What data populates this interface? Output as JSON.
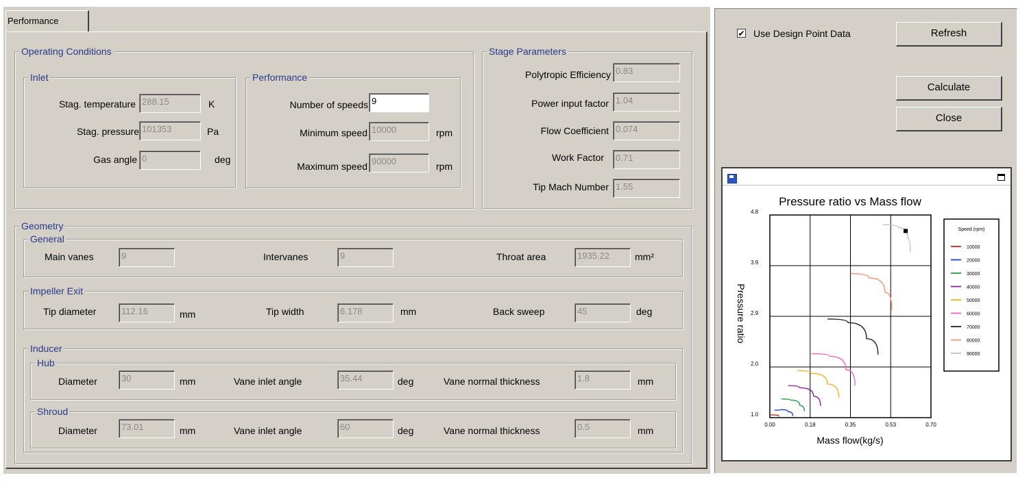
{
  "tab": {
    "label": "Performance"
  },
  "operating": {
    "title": "Operating Conditions",
    "inlet": {
      "title": "Inlet",
      "stag_temp": {
        "label": "Stag. temperature",
        "value": "288.15",
        "unit": "K"
      },
      "stag_pressure": {
        "label": "Stag. pressure",
        "value": "101353",
        "unit": "Pa"
      },
      "gas_angle": {
        "label": "Gas angle",
        "value": "0",
        "unit": "deg"
      }
    },
    "performance": {
      "title": "Performance",
      "num_speeds": {
        "label": "Number of speeds",
        "value": "9"
      },
      "min_speed": {
        "label": "Minimum speed",
        "value": "10000",
        "unit": "rpm"
      },
      "max_speed": {
        "label": "Maximum speed",
        "value": "90000",
        "unit": "rpm"
      }
    }
  },
  "stage": {
    "title": "Stage Parameters",
    "poly_eff": {
      "label": "Polytropic Efficiency",
      "value": "0.83"
    },
    "power_input": {
      "label": "Power input factor",
      "value": "1.04"
    },
    "flow_coef": {
      "label": "Flow Coefficient",
      "value": "0.074"
    },
    "work_factor": {
      "label": "Work Factor",
      "value": "0.71"
    },
    "tip_mach": {
      "label": "Tip Mach Number",
      "value": "1.55"
    }
  },
  "geometry": {
    "title": "Geometry",
    "general": {
      "title": "General",
      "main_vanes": {
        "label": "Main vanes",
        "value": "9"
      },
      "intervanes": {
        "label": "Intervanes",
        "value": "9"
      },
      "throat_area": {
        "label": "Throat area",
        "value": "1935.22",
        "unit": "mm²"
      }
    },
    "impeller_exit": {
      "title": "Impeller Exit",
      "tip_diameter": {
        "label": "Tip diameter",
        "value": "112.16",
        "unit": "mm"
      },
      "tip_width": {
        "label": "Tip width",
        "value": "6.178",
        "unit": "mm"
      },
      "back_sweep": {
        "label": "Back sweep",
        "value": "45",
        "unit": "deg"
      }
    },
    "inducer": {
      "title": "Inducer",
      "hub": {
        "title": "Hub",
        "diameter": {
          "label": "Diameter",
          "value": "30",
          "unit": "mm"
        },
        "vane_inlet_angle": {
          "label": "Vane inlet angle",
          "value": "35.44",
          "unit": "deg"
        },
        "vane_thickness": {
          "label": "Vane normal thickness",
          "value": "1.8",
          "unit": "mm"
        }
      },
      "shroud": {
        "title": "Shroud",
        "diameter": {
          "label": "Diameter",
          "value": "73.01",
          "unit": "mm"
        },
        "vane_inlet_angle": {
          "label": "Vane inlet angle",
          "value": "60",
          "unit": "deg"
        },
        "vane_thickness": {
          "label": "Vane normal thickness",
          "value": "0.5",
          "unit": "mm"
        }
      }
    }
  },
  "controls": {
    "use_design_point": {
      "label": "Use Design Point Data",
      "checked": true
    },
    "refresh": "Refresh",
    "calculate": "Calculate",
    "close": "Close"
  },
  "icons": {
    "save": "save-icon",
    "maximize": "maximize-icon",
    "check": "check-icon"
  },
  "colors": {
    "panel": "#d4d0c8",
    "group_title": "#2a3a8a",
    "disabled_text": "#8c8a84"
  },
  "chart_data": {
    "type": "line",
    "title": "Pressure ratio vs Mass flow",
    "xlabel": "Mass flow(kg/s)",
    "ylabel": "Pressure ratio",
    "xlim": [
      0,
      0.7
    ],
    "ylim": [
      1.0,
      4.8
    ],
    "xticks": [
      "0.00",
      "0.18",
      "0.35",
      "0.53",
      "0.70"
    ],
    "yticks": [
      "1.0",
      "2.0",
      "2.9",
      "3.9",
      "4.8"
    ],
    "grid": true,
    "legend_title": "Speed (rpm)",
    "legend_position": "right",
    "series": [
      {
        "name": "10000",
        "color": "#e02020",
        "x": [
          0.0,
          0.02,
          0.04
        ],
        "y": [
          1.05,
          1.05,
          1.02
        ]
      },
      {
        "name": "20000",
        "color": "#2040e0",
        "x": [
          0.02,
          0.05,
          0.08,
          0.1
        ],
        "y": [
          1.14,
          1.15,
          1.11,
          1.03
        ]
      },
      {
        "name": "30000",
        "color": "#20a040",
        "x": [
          0.05,
          0.09,
          0.13,
          0.15
        ],
        "y": [
          1.35,
          1.33,
          1.23,
          1.12
        ]
      },
      {
        "name": "40000",
        "color": "#9020a0",
        "x": [
          0.08,
          0.13,
          0.19,
          0.22
        ],
        "y": [
          1.6,
          1.56,
          1.4,
          1.22
        ]
      },
      {
        "name": "50000",
        "color": "#ffb020",
        "x": [
          0.12,
          0.18,
          0.25,
          0.3
        ],
        "y": [
          1.88,
          1.83,
          1.63,
          1.37
        ]
      },
      {
        "name": "60000",
        "color": "#ff60c0",
        "x": [
          0.18,
          0.26,
          0.33,
          0.37
        ],
        "y": [
          2.2,
          2.15,
          1.9,
          1.6
        ]
      },
      {
        "name": "70000",
        "color": "#202020",
        "x": [
          0.25,
          0.34,
          0.42,
          0.47
        ],
        "y": [
          2.85,
          2.78,
          2.48,
          2.18
        ]
      },
      {
        "name": "80000",
        "color": "#ff9070",
        "x": [
          0.35,
          0.43,
          0.5,
          0.53
        ],
        "y": [
          3.7,
          3.62,
          3.35,
          3.02
        ]
      },
      {
        "name": "90000",
        "color": "#c0c0c0",
        "x": [
          0.49,
          0.56,
          0.6,
          0.61
        ],
        "y": [
          4.62,
          4.56,
          4.35,
          4.1
        ]
      }
    ],
    "design_point": {
      "x": 0.59,
      "y": 4.5
    }
  }
}
